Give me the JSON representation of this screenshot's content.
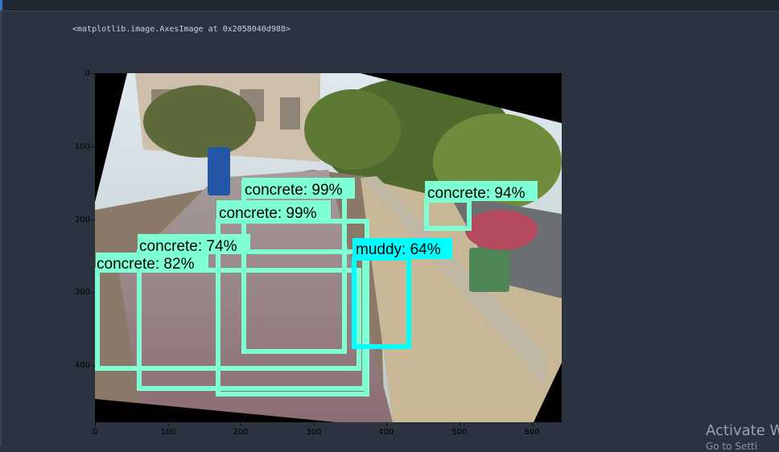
{
  "output": {
    "repr": "<matplotlib.image.AxesImage at 0x2058040d988>"
  },
  "chart_data": {
    "type": "image",
    "x_ticks": [
      "0",
      "100",
      "200",
      "300",
      "400",
      "500",
      "600"
    ],
    "y_ticks": [
      "0",
      "100",
      "200",
      "300",
      "400"
    ],
    "detections": [
      {
        "label": "concrete: 99%",
        "color": "#7fffd4"
      },
      {
        "label": "concrete: 99%",
        "color": "#7fffd4"
      },
      {
        "label": "concrete: 94%",
        "color": "#7fffd4"
      },
      {
        "label": "concrete: 74%",
        "color": "#7fffd4"
      },
      {
        "label": "concrete: 82%",
        "color": "#7fffd4"
      },
      {
        "label": "muddy: 64%",
        "color": "#00ffff"
      }
    ]
  },
  "watermark": {
    "line1": "Activate W",
    "line2": "Go to Setti"
  }
}
